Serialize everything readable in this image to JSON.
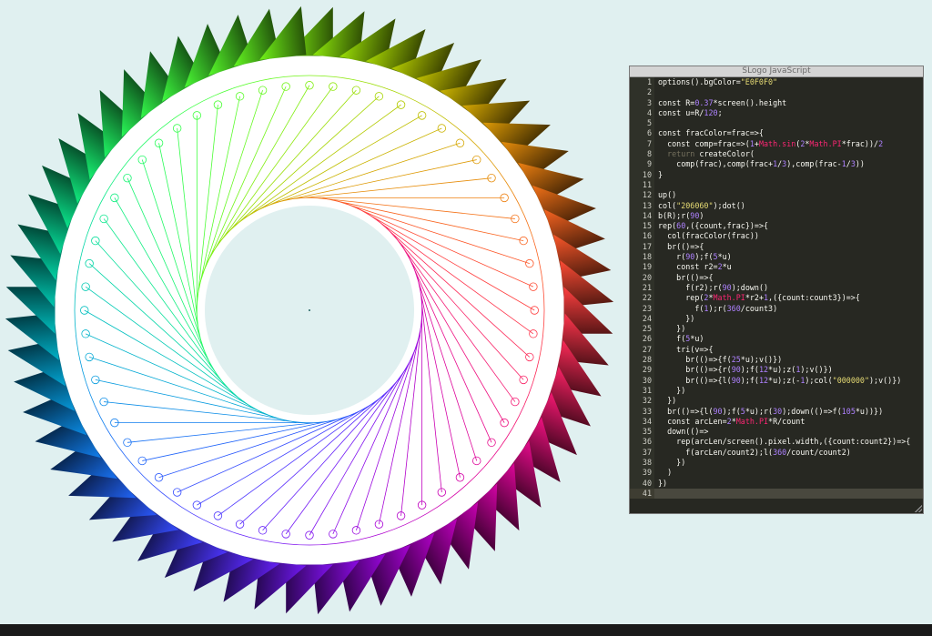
{
  "editor": {
    "title": "SLogo JavaScript",
    "lines": [
      {
        "n": "1",
        "code": "options().bgColor=\"E0F0F0\""
      },
      {
        "n": "2",
        "code": ""
      },
      {
        "n": "3",
        "code": "const R=0.37*screen().height"
      },
      {
        "n": "4",
        "code": "const u=R/120;"
      },
      {
        "n": "5",
        "code": ""
      },
      {
        "n": "6",
        "code": "const fracColor=frac=>{"
      },
      {
        "n": "7",
        "code": "  const comp=frac=>(1+Math.sin(2*Math.PI*frac))/2"
      },
      {
        "n": "8",
        "code": "  return createColor("
      },
      {
        "n": "9",
        "code": "    comp(frac),comp(frac+1/3),comp(frac-1/3))"
      },
      {
        "n": "10",
        "code": "}"
      },
      {
        "n": "11",
        "code": ""
      },
      {
        "n": "12",
        "code": "up()"
      },
      {
        "n": "13",
        "code": "col(\"206060\");dot()"
      },
      {
        "n": "14",
        "code": "b(R);r(90)"
      },
      {
        "n": "15",
        "code": "rep(60,({count,frac})=>{"
      },
      {
        "n": "16",
        "code": "  col(fracColor(frac))"
      },
      {
        "n": "17",
        "code": "  br(()=>{"
      },
      {
        "n": "18",
        "code": "    r(90);f(5*u)"
      },
      {
        "n": "19",
        "code": "    const r2=2*u"
      },
      {
        "n": "20",
        "code": "    br(()=>{"
      },
      {
        "n": "21",
        "code": "      f(r2);r(90);down()"
      },
      {
        "n": "22",
        "code": "      rep(2*Math.PI*r2+1,({count:count3})=>{"
      },
      {
        "n": "23",
        "code": "        f(1);r(360/count3)"
      },
      {
        "n": "24",
        "code": "      })"
      },
      {
        "n": "25",
        "code": "    })"
      },
      {
        "n": "26",
        "code": "    f(5*u)"
      },
      {
        "n": "27",
        "code": "    tri(v=>{"
      },
      {
        "n": "28",
        "code": "      br(()=>{f(25*u);v()})"
      },
      {
        "n": "29",
        "code": "      br(()=>{r(90);f(12*u);z(1);v()})"
      },
      {
        "n": "30",
        "code": "      br(()=>{l(90);f(12*u);z(-1);col(\"000000\");v()})"
      },
      {
        "n": "31",
        "code": "    })"
      },
      {
        "n": "32",
        "code": "  })"
      },
      {
        "n": "33",
        "code": "  br(()=>{l(90);f(5*u);r(30);down(()=>f(105*u))})"
      },
      {
        "n": "34",
        "code": "  const arcLen=2*Math.PI*R/count"
      },
      {
        "n": "35",
        "code": "  down(()=>"
      },
      {
        "n": "36",
        "code": "    rep(arcLen/screen().pixel.width,({count:count2})=>{"
      },
      {
        "n": "37",
        "code": "      f(arcLen/count2);l(360/count/count2)"
      },
      {
        "n": "38",
        "code": "    })"
      },
      {
        "n": "39",
        "code": "  )"
      },
      {
        "n": "40",
        "code": "})"
      },
      {
        "n": "41",
        "code": ""
      }
    ],
    "active_line": "41"
  },
  "canvas": {
    "background": "#E0F0F0",
    "center_dot_color": "#206060",
    "radius_factor": 0.37,
    "petal_count": 60
  }
}
